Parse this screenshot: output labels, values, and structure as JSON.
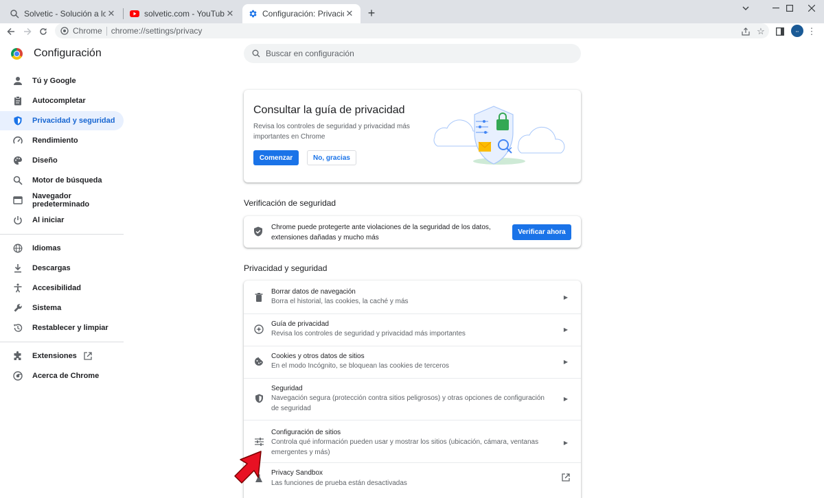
{
  "browser": {
    "tabs": [
      {
        "title": "Solvetic - Solución a los problemas",
        "favicon": "solvetic-favicon"
      },
      {
        "title": "solvetic.com - YouTube",
        "favicon": "youtube-favicon"
      },
      {
        "title": "Configuración: Privacidad y seguridad",
        "favicon": "gear-favicon"
      }
    ],
    "address": {
      "site_label": "Chrome",
      "url": "chrome://settings/privacy"
    }
  },
  "header": {
    "title": "Configuración",
    "search_placeholder": "Buscar en configuración"
  },
  "sidebar": {
    "items": [
      {
        "label": "Tú y Google",
        "icon": "person-icon"
      },
      {
        "label": "Autocompletar",
        "icon": "clipboard-icon"
      },
      {
        "label": "Privacidad y seguridad",
        "icon": "shield-icon",
        "active": true
      },
      {
        "label": "Rendimiento",
        "icon": "gauge-icon"
      },
      {
        "label": "Diseño",
        "icon": "palette-icon"
      },
      {
        "label": "Motor de búsqueda",
        "icon": "search-icon"
      },
      {
        "label": "Navegador predeterminado",
        "icon": "browser-icon"
      },
      {
        "label": "Al iniciar",
        "icon": "power-icon"
      },
      {
        "label": "Idiomas",
        "icon": "globe-icon"
      },
      {
        "label": "Descargas",
        "icon": "download-icon"
      },
      {
        "label": "Accesibilidad",
        "icon": "accessibility-icon"
      },
      {
        "label": "Sistema",
        "icon": "wrench-icon"
      },
      {
        "label": "Restablecer y limpiar",
        "icon": "history-icon"
      },
      {
        "label": "Extensiones",
        "icon": "puzzle-icon"
      },
      {
        "label": "Acerca de Chrome",
        "icon": "chrome-icon"
      }
    ]
  },
  "guide": {
    "title": "Consultar la guía de privacidad",
    "description": "Revisa los controles de seguridad y privacidad más importantes en Chrome",
    "start_label": "Comenzar",
    "dismiss_label": "No, gracias"
  },
  "safety_check": {
    "section_title": "Verificación de seguridad",
    "text": "Chrome puede protegerte ante violaciones de la seguridad de los datos, extensiones dañadas y mucho más",
    "button_label": "Verificar ahora"
  },
  "privacy": {
    "section_title": "Privacidad y seguridad",
    "rows": [
      {
        "title": "Borrar datos de navegación",
        "subtitle": "Borra el historial, las cookies, la caché y más",
        "icon": "trash-icon"
      },
      {
        "title": "Guía de privacidad",
        "subtitle": "Revisa los controles de seguridad y privacidad más importantes",
        "icon": "compass-icon"
      },
      {
        "title": "Cookies y otros datos de sitios",
        "subtitle": "En el modo Incógnito, se bloquean las cookies de terceros",
        "icon": "cookie-icon"
      },
      {
        "title": "Seguridad",
        "subtitle": "Navegación segura (protección contra sitios peligrosos) y otras opciones de configuración de seguridad",
        "icon": "shield-icon"
      },
      {
        "title": "Configuración de sitios",
        "subtitle": "Controla qué información pueden usar y mostrar los sitios (ubicación, cámara, ventanas emergentes y más)",
        "icon": "tune-icon"
      },
      {
        "title": "Privacy Sandbox",
        "subtitle": "Las funciones de prueba están desactivadas",
        "icon": "flask-icon"
      }
    ]
  },
  "colors": {
    "accent": "#1a73e8",
    "active_bg": "#e8f0fe",
    "annotation_arrow": "#e81123"
  }
}
